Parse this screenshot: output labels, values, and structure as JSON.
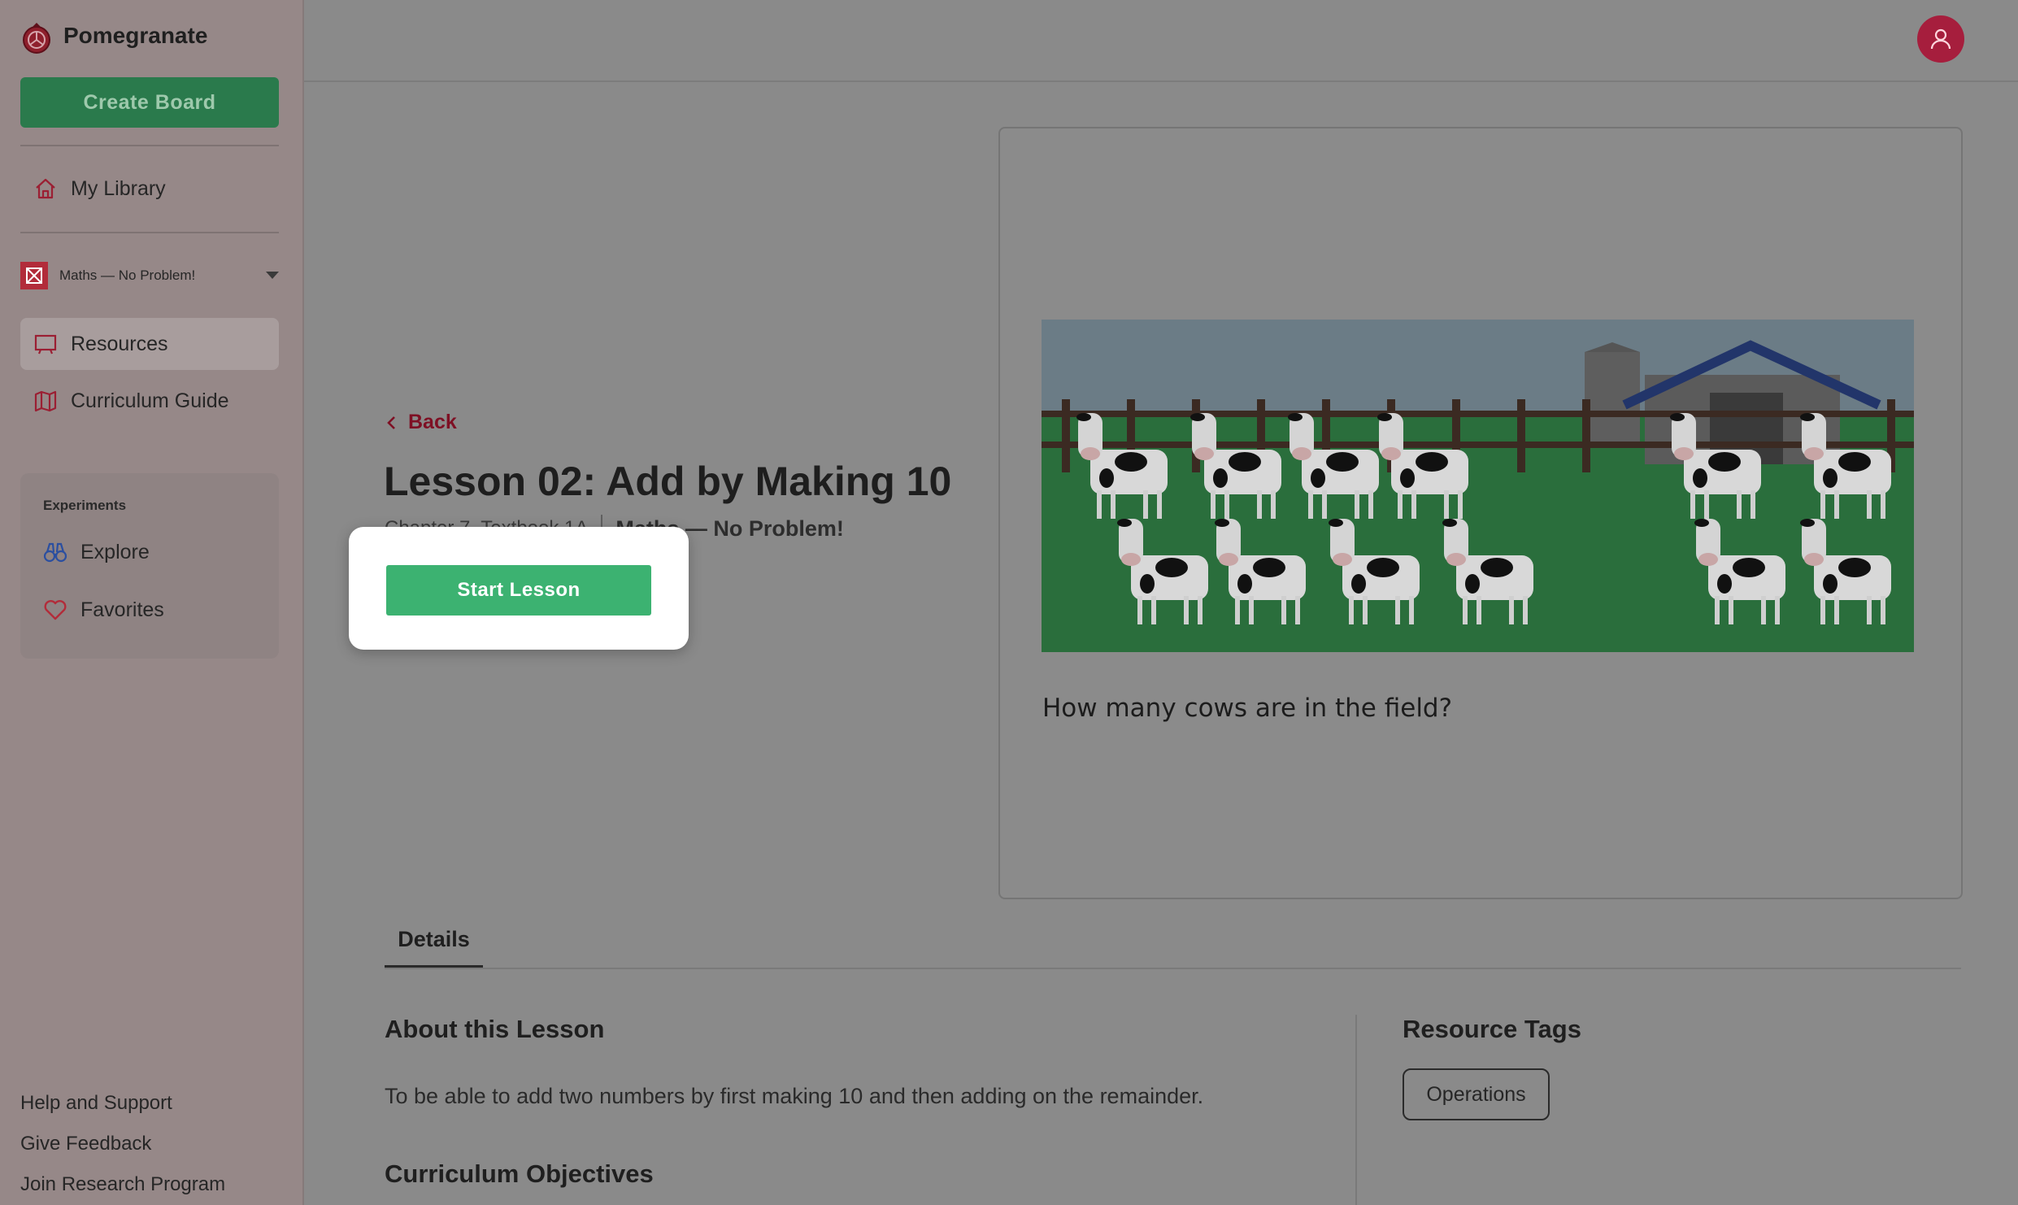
{
  "app": {
    "name": "Pomegranate",
    "brand_color": "#b22c3a",
    "accent_green": "#3cb271"
  },
  "sidebar": {
    "create_board_label": "Create Board",
    "library_label": "My Library",
    "course_selector": "Maths — No Problem!",
    "nav": [
      {
        "label": "Resources",
        "icon": "chalkboard-icon",
        "active": true
      },
      {
        "label": "Curriculum Guide",
        "icon": "map-icon",
        "active": false
      }
    ],
    "experiments": {
      "title": "Experiments",
      "items": [
        {
          "label": "Explore",
          "icon": "binoculars-icon"
        },
        {
          "label": "Favorites",
          "icon": "heart-icon"
        }
      ]
    },
    "footer_links": [
      "Help and Support",
      "Give Feedback",
      "Join Research Program"
    ]
  },
  "header": {
    "avatar_icon": "user-icon"
  },
  "lesson": {
    "back_label": "Back",
    "title": "Lesson 02: Add by Making 10",
    "chapter": "Chapter 7, Textbook 1A",
    "course": "Maths — No Problem!",
    "start_label": "Start Lesson",
    "preview_question": "How many cows are in the field?"
  },
  "tabs": [
    {
      "label": "Details",
      "active": true
    }
  ],
  "details": {
    "about_heading": "About this Lesson",
    "about_text": "To be able to add two numbers by first making 10 and then adding on the remainder.",
    "objectives_heading": "Curriculum Objectives",
    "tags_heading": "Resource Tags",
    "tags": [
      "Operations"
    ]
  }
}
